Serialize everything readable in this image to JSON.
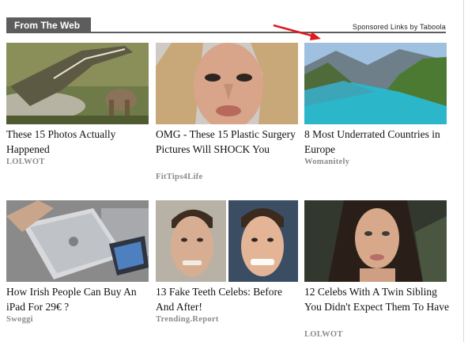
{
  "header": {
    "section_label": "From The Web",
    "sponsor_text": "Sponsored Links by Taboola",
    "accent_color": "#5d5d5d",
    "arrow_color": "#e0191f"
  },
  "cards": [
    {
      "title": "These 15 Photos Actually Happened",
      "source": "LOLWOT",
      "image": "crocodile-attack-photo"
    },
    {
      "title": "OMG - These 15 Plastic Surgery Pictures Will SHOCK You",
      "source": "FitTips4Life",
      "image": "plastic-surgery-face-photo"
    },
    {
      "title": "8 Most Underrated Countries in Europe",
      "source": "Womanitely",
      "image": "mountain-lake-landscape-photo"
    },
    {
      "title": "How Irish People Can Buy An iPad For 29€ ?",
      "source": "Swoggi",
      "image": "ipad-boxes-photo"
    },
    {
      "title": "13 Fake Teeth Celebs: Before And After!",
      "source": "Trending.Report",
      "image": "celebrity-before-after-photo"
    },
    {
      "title": "12 Celebs With A Twin Sibling You Didn't Expect Them To Have",
      "source": "LOLWOT",
      "image": "woman-portrait-photo"
    }
  ]
}
